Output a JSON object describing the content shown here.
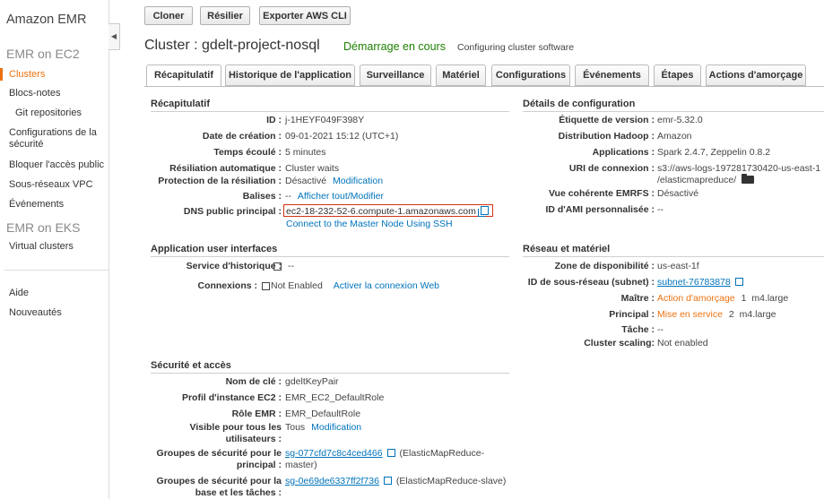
{
  "sidebar": {
    "title": "Amazon EMR",
    "section_ec2": "EMR on EC2",
    "items": [
      {
        "label": "Clusters"
      },
      {
        "label": "Blocs-notes"
      },
      {
        "label": "Git repositories"
      },
      {
        "label": "Configurations de la sécurité"
      },
      {
        "label": "Bloquer l'accès public"
      },
      {
        "label": "Sous-réseaux VPC"
      },
      {
        "label": "Événements"
      }
    ],
    "section_eks": "EMR on EKS",
    "eks_items": [
      {
        "label": "Virtual clusters"
      }
    ],
    "bottom_items": [
      {
        "label": "Aide"
      },
      {
        "label": "Nouveautés"
      }
    ],
    "collapse_glyph": "◀"
  },
  "toolbar": {
    "clone_label": "Cloner",
    "terminate_label": "Résilier",
    "export_label": "Exporter AWS CLI"
  },
  "cluster": {
    "title": "Cluster : gdelt-project-nosql",
    "status": "Démarrage en cours",
    "status_detail": "Configuring cluster software"
  },
  "tabs": [
    {
      "label": "Récapitulatif"
    },
    {
      "label": "Historique de l'application"
    },
    {
      "label": "Surveillance"
    },
    {
      "label": "Matériel"
    },
    {
      "label": "Configurations"
    },
    {
      "label": "Événements"
    },
    {
      "label": "Étapes"
    },
    {
      "label": "Actions d'amorçage"
    }
  ],
  "summary": {
    "title": "Récapitulatif",
    "id_label": "ID :",
    "id": "j-1HEYF049F398Y",
    "created_label": "Date de création :",
    "created": "09-01-2021 15:12 (UTC+1)",
    "elapsed_label": "Temps écoulé :",
    "elapsed": "5 minutes",
    "autoterm_label": "Résiliation automatique :",
    "autoterm": "Cluster waits",
    "protect_label": "Protection de la résiliation :",
    "protect": "Désactivé",
    "protect_link": "Modification",
    "tags_label": "Balises :",
    "tags": "--",
    "tags_link": "Afficher tout/Modifier",
    "dns_label": "DNS public principal :",
    "dns": "ec2-18-232-52-6.compute-1.amazonaws.com",
    "ssh_link": "Connect to the Master Node Using SSH"
  },
  "config": {
    "title": "Détails de configuration",
    "release_label": "Étiquette de version :",
    "release": "emr-5.32.0",
    "hadoop_label": "Distribution Hadoop :",
    "hadoop": "Amazon",
    "apps_label": "Applications :",
    "apps": "Spark 2.4.7, Zeppelin 0.8.2",
    "log_label": "URI de connexion :",
    "log_line1": "s3://aws-logs-197281730420-us-east-1",
    "log_line2": "/elasticmapreduce/",
    "emrfs_label": "Vue cohérente EMRFS :",
    "emrfs": "Désactivé",
    "ami_label": "ID d'AMI personnalisée :",
    "ami": "--"
  },
  "app_ui": {
    "title": "Application user interfaces",
    "history_label": "Service d'historique :",
    "history": "--",
    "conn_label": "Connexions :",
    "conn": "Not Enabled",
    "conn_link": "Activer la connexion Web"
  },
  "network": {
    "title": "Réseau et matériel",
    "az_label": "Zone de disponibilité :",
    "az": "us-east-1f",
    "subnet_label": "ID de sous-réseau (subnet) :",
    "subnet": "subnet-76783878",
    "master_label": "Maître :",
    "master_status": "Action d'amorçage",
    "master_count": "1",
    "master_type": "m4.large",
    "core_label": "Principal :",
    "core_status": "Mise en service",
    "core_count": "2",
    "core_type": "m4.large",
    "task_label": "Tâche :",
    "task": "--",
    "scaling_label": "Cluster scaling:",
    "scaling": "Not enabled"
  },
  "security": {
    "title": "Sécurité et accès",
    "key_label": "Nom de clé :",
    "key": "gdeltKeyPair",
    "profile_label": "Profil d'instance EC2 :",
    "profile": "EMR_EC2_DefaultRole",
    "role_label": "Rôle EMR :",
    "role": "EMR_DefaultRole",
    "visible_label1": "Visible pour tous les",
    "visible_label2": "utilisateurs :",
    "visible": "Tous",
    "visible_link": "Modification",
    "sg_master_label1": "Groupes de sécurité pour le",
    "sg_master_label2": "principal :",
    "sg_master": "sg-077cfd7c8c4ced466",
    "sg_master_desc1": "(ElasticMapReduce-",
    "sg_master_desc2": "master)",
    "sg_slave_label1": "Groupes de sécurité pour la",
    "sg_slave_label2": "base et les tâches :",
    "sg_slave": "sg-0e69de6337ff2f736",
    "sg_slave_desc": "(ElasticMapReduce-slave)"
  }
}
